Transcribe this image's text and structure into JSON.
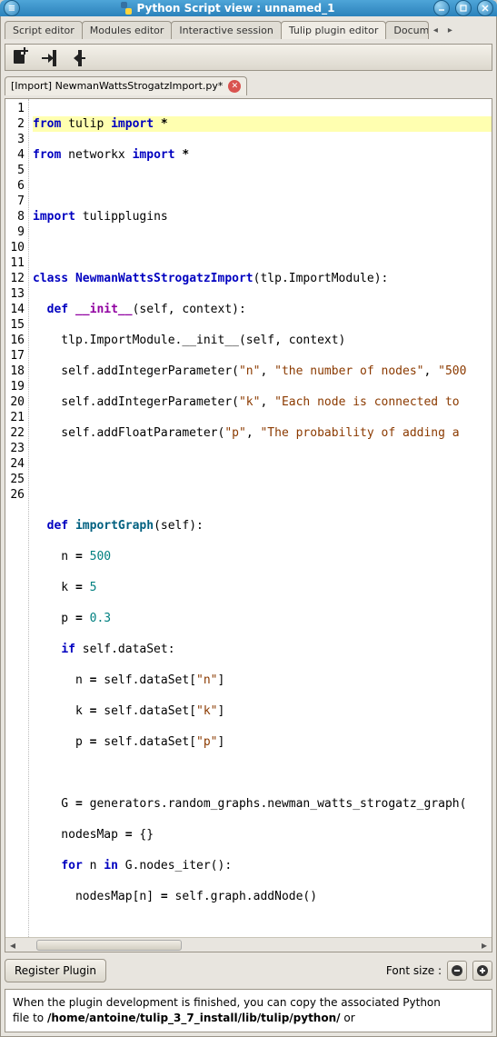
{
  "titlebar": {
    "title": "Python Script view : unnamed_1"
  },
  "tabs": {
    "items": [
      "Script editor",
      "Modules editor",
      "Interactive session",
      "Tulip plugin editor",
      "Docum"
    ],
    "active_index": 3
  },
  "filetab": {
    "label": "[Import] NewmanWattsStrogatzImport.py*"
  },
  "code": {
    "line_numbers": [
      "1",
      "2",
      "3",
      "4",
      "5",
      "6",
      "7",
      "8",
      "9",
      "10",
      "11",
      "12",
      "13",
      "14",
      "15",
      "16",
      "17",
      "18",
      "19",
      "20",
      "21",
      "22",
      "23",
      "24",
      "25",
      "26"
    ],
    "l1_from": "from",
    "l1_mod": "tulip",
    "l1_import": "import",
    "l1_star": "*",
    "l2_from": "from",
    "l2_mod": "networkx",
    "l2_import": "import",
    "l2_star": "*",
    "l4_import": "import",
    "l4_mod": "tulipplugins",
    "l6_class": "class",
    "l6_name": "NewmanWattsStrogatzImport",
    "l6_rest": "(tlp.ImportModule):",
    "l7_def": "def",
    "l7_name": "__init__",
    "l7_rest": "(self, context):",
    "l8": "    tlp.ImportModule.__init__(self, context)",
    "l9a": "    self.addIntegerParameter(",
    "l9s1": "\"n\"",
    "l9c": ", ",
    "l9s2": "\"the number of nodes\"",
    "l9d": ", ",
    "l9s3": "\"500",
    "l10a": "    self.addIntegerParameter(",
    "l10s1": "\"k\"",
    "l10c": ", ",
    "l10s2": "\"Each node is connected to ",
    "l11a": "    self.addFloatParameter(",
    "l11s1": "\"p\"",
    "l11c": ", ",
    "l11s2": "\"The probability of adding a ",
    "l14_def": "def",
    "l14_name": "importGraph",
    "l14_rest": "(self):",
    "l15a": "    n ",
    "l15eq": "=",
    "l15v": " 500",
    "l16a": "    k ",
    "l16eq": "=",
    "l16v": " 5",
    "l17a": "    p ",
    "l17eq": "=",
    "l17v": " 0.3",
    "l18_if": "if",
    "l18_rest": " self.dataSet:",
    "l19a": "      n ",
    "l19eq": "=",
    "l19b": " self.dataSet[",
    "l19s": "\"n\"",
    "l19c": "]",
    "l20a": "      k ",
    "l20eq": "=",
    "l20b": " self.dataSet[",
    "l20s": "\"k\"",
    "l20c": "]",
    "l21a": "      p ",
    "l21eq": "=",
    "l21b": " self.dataSet[",
    "l21s": "\"p\"",
    "l21c": "]",
    "l23a": "    G ",
    "l23eq": "=",
    "l23b": " generators.random_graphs.newman_watts_strogatz_graph(",
    "l24a": "    nodesMap ",
    "l24eq": "=",
    "l24b": " {}",
    "l25_for": "for",
    "l25_a": " n ",
    "l25_in": "in",
    "l25_b": " G.nodes_iter():",
    "l26a": "      nodesMap[n] ",
    "l26eq": "=",
    "l26b": " self.graph.addNode()"
  },
  "bottom": {
    "register_label": "Register Plugin",
    "font_label": "Font size :"
  },
  "info": {
    "text1": "When the plugin development is finished, you can copy the associated Python",
    "text2a": "file to ",
    "text2b": "/home/antoine/tulip_3_7_install/lib/tulip/python/",
    "text2c": " or"
  }
}
